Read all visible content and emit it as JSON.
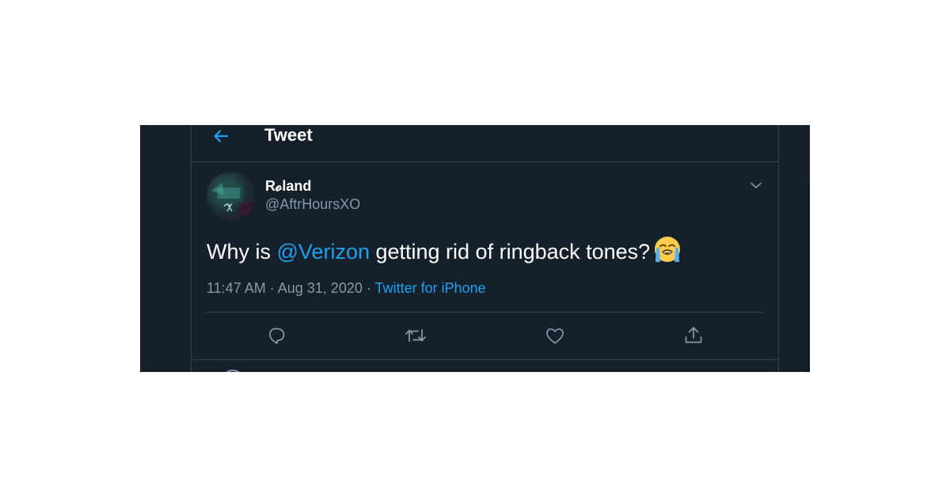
{
  "header": {
    "title": "Tweet",
    "back_icon": "arrow-left-icon"
  },
  "tweet": {
    "author": {
      "display_name": "R𝓸land",
      "handle": "@AftrHoursXO",
      "avatar_icon": "avatar"
    },
    "text": {
      "before": "Why is ",
      "mention": "@Verizon",
      "after": " getting rid of ringback tones?",
      "emoji": "loudly-crying-face-emoji"
    },
    "time": "11:47 AM",
    "separator": "·",
    "date": "Aug 31, 2020",
    "source": "Twitter for iPhone"
  },
  "actions": [
    {
      "name": "reply",
      "icon": "reply-icon"
    },
    {
      "name": "retweet",
      "icon": "retweet-icon"
    },
    {
      "name": "like",
      "icon": "heart-icon"
    },
    {
      "name": "share",
      "icon": "share-icon"
    }
  ],
  "colors": {
    "background": "#15202b",
    "border": "#38444d",
    "accent": "#1da1f2",
    "secondary_text": "#8899a6",
    "primary_text": "#ffffff"
  }
}
